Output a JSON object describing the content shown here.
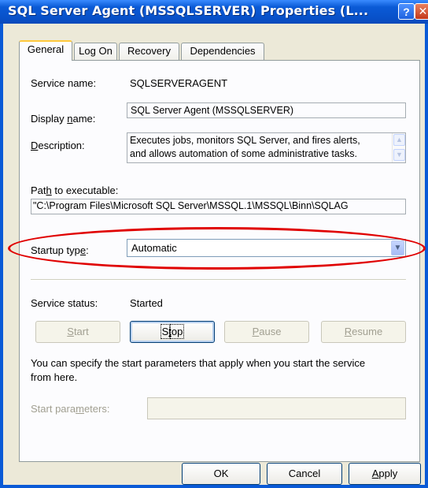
{
  "window": {
    "title": "SQL Server Agent (MSSQLSERVER) Properties (L...",
    "help_label": "?",
    "close_label": "✕"
  },
  "tabs": [
    {
      "label": "General",
      "active": true
    },
    {
      "label": "Log On",
      "active": false
    },
    {
      "label": "Recovery",
      "active": false
    },
    {
      "label": "Dependencies",
      "active": false
    }
  ],
  "general": {
    "service_name_label": "Service name:",
    "service_name_value": "SQLSERVERAGENT",
    "display_name_label_pre": "Display ",
    "display_name_label_acc": "n",
    "display_name_label_post": "ame:",
    "display_name_value": "SQL Server Agent (MSSQLSERVER)",
    "description_label_acc": "D",
    "description_label_post": "escription:",
    "description_line1": "Executes jobs, monitors SQL Server, and fires alerts,",
    "description_line2": "and allows automation of some administrative tasks.",
    "path_label_pre": "Pat",
    "path_label_acc": "h",
    "path_label_post": " to executable:",
    "path_value": "\"C:\\Program Files\\Microsoft SQL Server\\MSSQL.1\\MSSQL\\Binn\\SQLAG",
    "startup_type_label_pre": "Startup typ",
    "startup_type_label_acc": "e",
    "startup_type_label_post": ":",
    "startup_type_value": "Automatic",
    "service_status_label": "Service status:",
    "service_status_value": "Started",
    "buttons": {
      "start_acc": "S",
      "start_post": "tart",
      "stop_pre": "S",
      "stop_acc": "t",
      "stop_post": "op",
      "pause_acc": "P",
      "pause_post": "ause",
      "resume_acc": "R",
      "resume_post": "esume"
    },
    "help_text_line1": "You can specify the start parameters that apply when you start the service",
    "help_text_line2": "from here.",
    "start_params_label_pre": "Start para",
    "start_params_label_acc": "m",
    "start_params_label_post": "eters:",
    "start_params_value": ""
  },
  "footer": {
    "ok_label": "OK",
    "cancel_label": "Cancel",
    "apply_acc": "A",
    "apply_post": "pply"
  },
  "colors": {
    "titlebar": "#0a5ad6",
    "dialog_bg": "#ece9d8",
    "highlight_ring": "#e00000"
  }
}
